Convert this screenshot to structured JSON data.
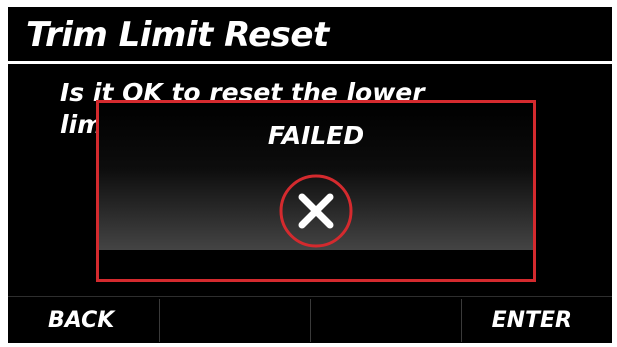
{
  "title": "Trim Limit Reset",
  "message": "Is it OK to reset the lower\nlimit?",
  "dialog": {
    "title": "FAILED",
    "icon": "x-circle-icon",
    "border_color": "#d42a2e"
  },
  "softkeys": {
    "back": "BACK",
    "key2": "",
    "key3": "",
    "enter": "ENTER"
  },
  "colors": {
    "background": "#000000",
    "text": "#ffffff",
    "accent": "#d42a2e"
  }
}
